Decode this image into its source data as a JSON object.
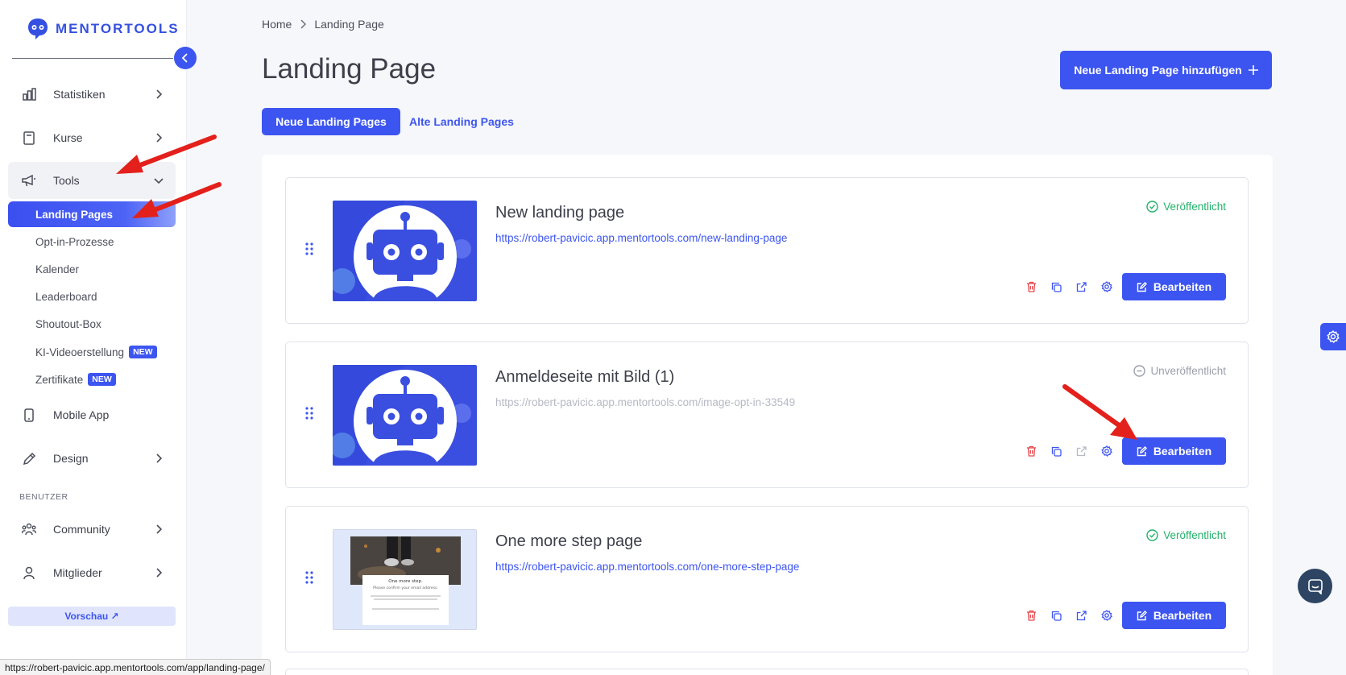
{
  "brand": {
    "name": "MENTORTOOLS",
    "color": "#3d55f0"
  },
  "sidebar": {
    "items": [
      {
        "label": "Statistiken",
        "icon": "bar-chart-icon"
      },
      {
        "label": "Kurse",
        "icon": "book-icon"
      },
      {
        "label": "Tools",
        "icon": "megaphone-icon"
      },
      {
        "label": "Mobile App",
        "icon": "phone-icon"
      },
      {
        "label": "Design",
        "icon": "pencil-icon"
      },
      {
        "label": "Community",
        "icon": "users-icon"
      },
      {
        "label": "Mitglieder",
        "icon": "user-icon"
      }
    ],
    "tools_sub": [
      {
        "label": "Landing Pages"
      },
      {
        "label": "Opt-in-Prozesse"
      },
      {
        "label": "Kalender"
      },
      {
        "label": "Leaderboard"
      },
      {
        "label": "Shoutout-Box"
      },
      {
        "label": "KI-Videoerstellung",
        "badge": "NEW"
      },
      {
        "label": "Zertifikate",
        "badge": "NEW"
      }
    ],
    "section_label": "BENUTZER",
    "preview_label": "Vorschau ↗"
  },
  "breadcrumb": {
    "home": "Home",
    "current": "Landing Page"
  },
  "page": {
    "title": "Landing Page",
    "add_button": "Neue Landing Page hinzufügen",
    "tabs": {
      "active": "Neue Landing Pages",
      "other": "Alte Landing Pages"
    }
  },
  "cards": [
    {
      "title": "New landing page",
      "url": "https://robert-pavicic.app.mentortools.com/new-landing-page",
      "status": "Veröffentlicht",
      "published": true,
      "edit": "Bearbeiten"
    },
    {
      "title": "Anmeldeseite mit Bild (1)",
      "url": "https://robert-pavicic.app.mentortools.com/image-opt-in-33549",
      "status": "Unveröffentlicht",
      "published": false,
      "edit": "Bearbeiten"
    },
    {
      "title": "One more step page",
      "url": "https://robert-pavicic.app.mentortools.com/one-more-step-page",
      "status": "Veröffentlicht",
      "published": true,
      "edit": "Bearbeiten"
    }
  ],
  "thumbnail_text": {
    "heading": "One more step.",
    "sub": "Please confirm your email address."
  },
  "statusbar": {
    "url": "https://robert-pavicic.app.mentortools.com/app/landing-page/"
  },
  "colors": {
    "accent": "#3d55f0",
    "published": "#22b26b",
    "unpublished": "#9b9eab",
    "delete": "#e5484d",
    "annotation_arrow": "#e3201b"
  }
}
